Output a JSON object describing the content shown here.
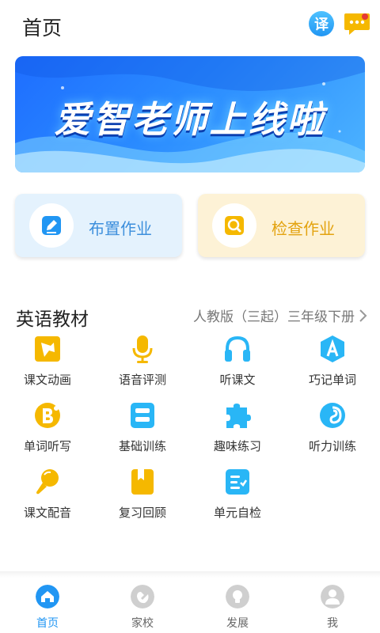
{
  "header": {
    "title": "首页",
    "translate_label": "译"
  },
  "banner": {
    "title": "爱智老师上线啦"
  },
  "actions": {
    "assign_label": "布置作业",
    "check_label": "检查作业"
  },
  "section": {
    "title": "英语教材",
    "textbook": "人教版（三起）三年级下册"
  },
  "features": [
    {
      "label": "课文动画",
      "icon": "puzzle-star-icon"
    },
    {
      "label": "语音评测",
      "icon": "microphone-icon"
    },
    {
      "label": "听课文",
      "icon": "headphones-icon"
    },
    {
      "label": "巧记单词",
      "icon": "letter-a-badge-icon"
    },
    {
      "label": "单词听写",
      "icon": "dictation-b-icon"
    },
    {
      "label": "基础训练",
      "icon": "training-list-icon"
    },
    {
      "label": "趣味练习",
      "icon": "puzzle-piece-icon"
    },
    {
      "label": "听力训练",
      "icon": "listening-ear-icon"
    },
    {
      "label": "课文配音",
      "icon": "dubbing-microphone-icon"
    },
    {
      "label": "复习回顾",
      "icon": "bookmark-book-icon"
    },
    {
      "label": "单元自检",
      "icon": "checklist-icon"
    }
  ],
  "nav": [
    {
      "label": "首页",
      "active": true
    },
    {
      "label": "家校",
      "active": false
    },
    {
      "label": "发展",
      "active": false
    },
    {
      "label": "我",
      "active": false
    }
  ],
  "colors": {
    "primary_blue": "#2196f3",
    "accent_yellow": "#f5b800",
    "assign_card_bg": "#e4f2fd",
    "check_card_bg": "#fdf2d6"
  }
}
